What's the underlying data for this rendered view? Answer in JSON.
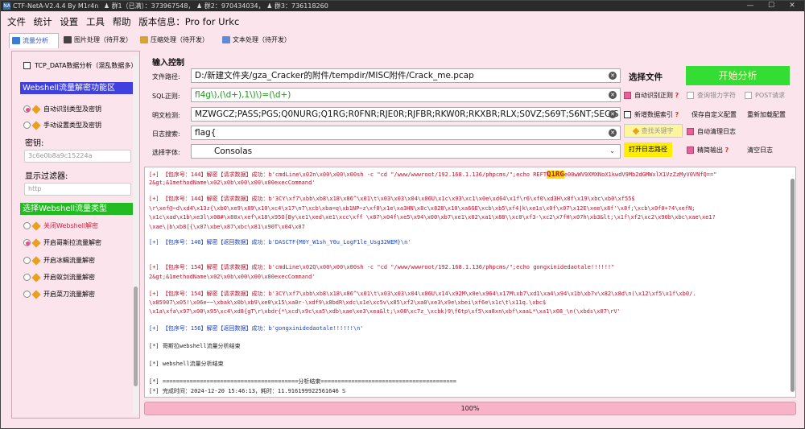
{
  "titlebar": {
    "icon_text": "NA",
    "title": "CTF-NetA-V2.4.4 By M1r4n",
    "qq1": "群1（已满）：373967548，",
    "qq2": "群2：970434034，",
    "qq3": "群3：736118260",
    "minimize": "—",
    "maximize": "☐",
    "close": "✕"
  },
  "menu": [
    "文件",
    "统计",
    "设置",
    "工具",
    "帮助",
    "版本信息：Pro for Urkc"
  ],
  "tabs": [
    "流量分析",
    "图片处理（待开发）",
    "压缩处理（待开发）",
    "文本处理（待开发）"
  ],
  "left": {
    "tcp_data": "TCP_DATA数据分析（混乱数据多）",
    "ws_header": "Webshell流量解密功能区",
    "auto_identify": "自动识别类型及密钥",
    "manual_set": "手动设置类型及密钥",
    "key_label": "密钥:",
    "key_placeholder": "3c6e0b8a9c15224a",
    "filter_label": "显示过滤器:",
    "filter_placeholder": "http",
    "type_header": "选择Webshell流量类型",
    "types": [
      "关闭Webshell解密",
      "开启哥斯拉流量解密",
      "开启冰蝎流量解密",
      "开启蚁剑流量解密",
      "开启菜刀流量解密"
    ]
  },
  "input": {
    "section": "输入控制",
    "file_label": "文件路径:",
    "file_value": "D:/新建文件夹/gza_Cracker的附件/tempdir/MISC附件/Crack_me.pcap",
    "select_file": "选择文件",
    "start": "开始分析",
    "sql_label": "SQL正则:",
    "sql_value": "fl4g\\),(\\d+),1\\)\\)=(\\d+)",
    "auto_regex": "自动识别正则",
    "query_char": "查询错力字符",
    "post_req": "POST请求",
    "plain_label": "明文检测:",
    "plain_value": "MZWGCZ;PASS;PGS;Q0NURG;Q1RG;R0FNR;RJE0R;RJFBR;RKW0R;RKXBR;RLX;S0VZ;S69T;S6NT;SEC;S",
    "new_index": "新增数据索引",
    "save_custom": "保存自定义配置",
    "reload": "重新加载配置",
    "log_label": "日志搜索:",
    "log_value": "flag{",
    "find_key": "查找关键字",
    "auto_clear": "自动清理日志",
    "font_label": "选择字体:",
    "font_value": "Consolas",
    "open_log": "打开日志路径",
    "precise": "精简输出",
    "clear_log": "清空日志"
  },
  "output": [
    {
      "c": "red",
      "t": "[+] 【包序号：144】解密【请求数据】成功：b'cmdLine\\x02n\\x00\\x00\\x00sh -c \"cd \"/www/wwwroot/192.168.1.136/phpcms/\";echo REFT"
    },
    {
      "c": "red",
      "t": "2&gt;&1methodName\\x02\\x0b\\x00\\x00\\x00execCommand'"
    },
    {
      "c": "red",
      "t": "[+] 【包序号：144】解密【请求数据】成功：b'3CY\\xf7\\xbb\\xb8\\x18\\x86^\\x01\\t\\x03\\x03\\x04\\x06U\\x1c\\x93\\xc1\\x0e\\xd64\\x1f\\r6\\xf0\\xd3H\\x8f\\x19\\xbc\\xb0\\xf55$"
    },
    {
      "c": "red",
      "t": "\\r\\xef@~d\\xd4\\x13z{\\xb0\\xe9\\x89\\x10\\xc4\\x17\\n7\\xcb\\xba=q\\xb1NP~z\\xf0\\x1e\\xa3HN\\x8c\\x828\\x10\\xa6GE\\xcb\\xb5\\xf4|k\\xe1s\\x0f\\x07\\x12E\\xee\\x8f'\\x8f;\\xcb\\x0f0+?4\\xefN;"
    },
    {
      "c": "red",
      "t": "\\x1c\\xad\\x1b\\xe3l\\x08#\\x80x\\xef\\x18\\x95O[By\\xe1\\xed\\xe1\\xcc\\xff \\x87\\x04f\\xe5\\x94\\x00\\xb7\\xe1\\x02\\xa1\\x88\\\\xc0\\xf3-\\xc2\\x7fH\\x07h\\xb3&lt;\\x1f\\xf2\\xc2\\x90b\\xbc\\xae\\xe1?"
    },
    {
      "c": "red",
      "t": "\\xae\\|b\\xb8[{\\x07\\xbe\\x87\\xbc\\x81\\x90T\\x04\\x07"
    },
    {
      "c": "blue",
      "t": "[+] 【包序号：146】解密【返回数据】成功：b'DASCTF{M0Y_W1sh_Y0u_LogF1le_Usg32WEM}\\n'"
    },
    {
      "c": "red",
      "t": "[+] 【包序号：154】解密【请求数据】成功：b'cmdLine\\x02Q\\x00\\x00\\x00sh -c \"cd \"/www/wwwroot/192.168.1.136/phpcms/\";echo gongxinidedaotale!!!!!!\""
    },
    {
      "c": "red",
      "t": "2&gt;&1methodName\\x02\\x0b\\x00\\x00\\x00execCommand'"
    },
    {
      "c": "red",
      "t": "[+] 【包序号：154】解密【请求数据】成功：b'3CY\\xf7\\xbb\\xb8\\x18\\x86^\\x01\\t\\x03\\x03\\x04\\x06U\\x14\\x92M\\x0e\\x964\\x17M\\xb7\\xd1\\xa4\\x94\\x1b\\xb7v\\x82\\x8d\\n(\\x12\\xf5\\x1f\\xb0/."
    },
    {
      "c": "red",
      "t": "\\x85907\\x05!\\x06e~~\\xbak\\x0b\\xb9\\xe0\\x15\\xa0r-\\xdf9\\x8bdR\\xdc\\x1e\\xc5v\\x85\\xf2\\xa0\\xe3\\x9e\\xbei\\xf6e\\x1c\\t\\x11q.\\xbc$"
    },
    {
      "c": "red",
      "t": "\\x1a\\xfa\\x97\\x00\\x95\\xc4\\xd8{gT\\r\\xbdr{*\\xcd\\x9c\\xa5\\xdb\\xae\\xe3\\xea&lt;\\x08\\xc7z_\\xcbk)9\\f6tp\\xf5\\xa8xn\\xbf\\xaaL*\\xa1\\x08_\\n(\\xbds\\x07\\rV'"
    },
    {
      "c": "blue",
      "t": "[+] 【包序号：156】解密【返回数据】成功：b'gongxinidedaotale!!!!!!\\n'"
    },
    {
      "c": "blk",
      "t": "[*] 哥斯拉webshell流量分析结束"
    },
    {
      "c": "blk",
      "t": "[*] webshell流量分析结束"
    },
    {
      "c": "blk",
      "t": "[*] ========================================分析结束========================================"
    },
    {
      "c": "blk",
      "t": "[*] 完成时间：2024-12-20 15:46:13，耗时：11.916199922561646 S"
    }
  ],
  "output_line0_highlight": "Q1RG",
  "output_line0_tail": "e00wWV9XMXNoX1kwdV9Mb2dGMWxlX1VzZzMyV0VNfQ==\"",
  "progress": {
    "value": 1.0,
    "text": "100%"
  },
  "colors": {
    "bg": "#fce4ec",
    "accent": "#e8609a",
    "start_button": "#33dd33",
    "find_button": "#fff59d",
    "open_log_button": "#ffee00"
  }
}
